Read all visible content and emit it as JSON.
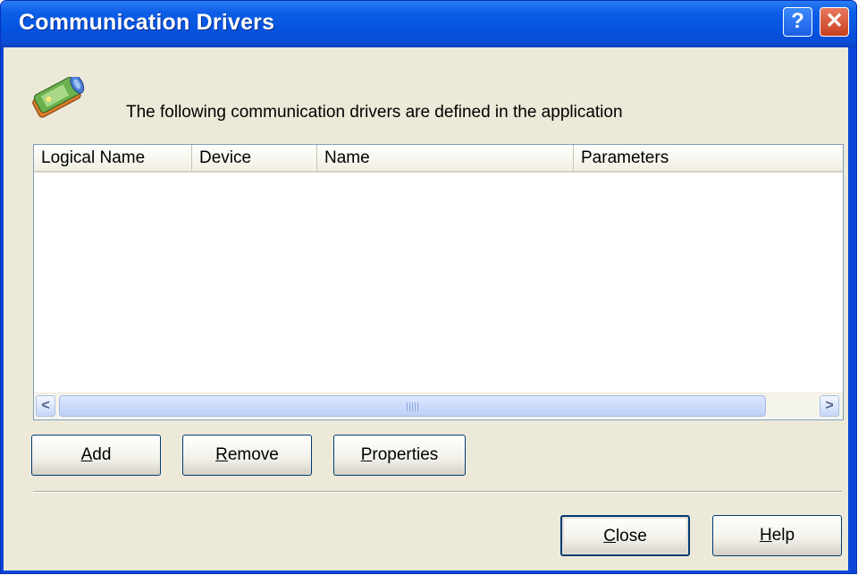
{
  "window": {
    "title": "Communication Drivers",
    "help_glyph": "?",
    "close_glyph": "✕"
  },
  "header": {
    "icon": "drivers-icon",
    "description": "The following communication drivers are defined in the application"
  },
  "list": {
    "columns": [
      "Logical Name",
      "Device",
      "Name",
      "Parameters"
    ],
    "rows": [],
    "scroll_left_glyph": "<",
    "scroll_right_glyph": ">"
  },
  "buttons": {
    "add": {
      "accel": "A",
      "rest": "dd"
    },
    "remove": {
      "accel": "R",
      "rest": "emove"
    },
    "properties": {
      "accel": "P",
      "rest": "roperties"
    },
    "close": {
      "accel": "C",
      "rest": "lose"
    },
    "help": {
      "accel": "H",
      "rest": "elp"
    }
  },
  "colors": {
    "titlebar": "#0454e0",
    "client": "#ece9d8",
    "close_button": "#c8401f"
  }
}
